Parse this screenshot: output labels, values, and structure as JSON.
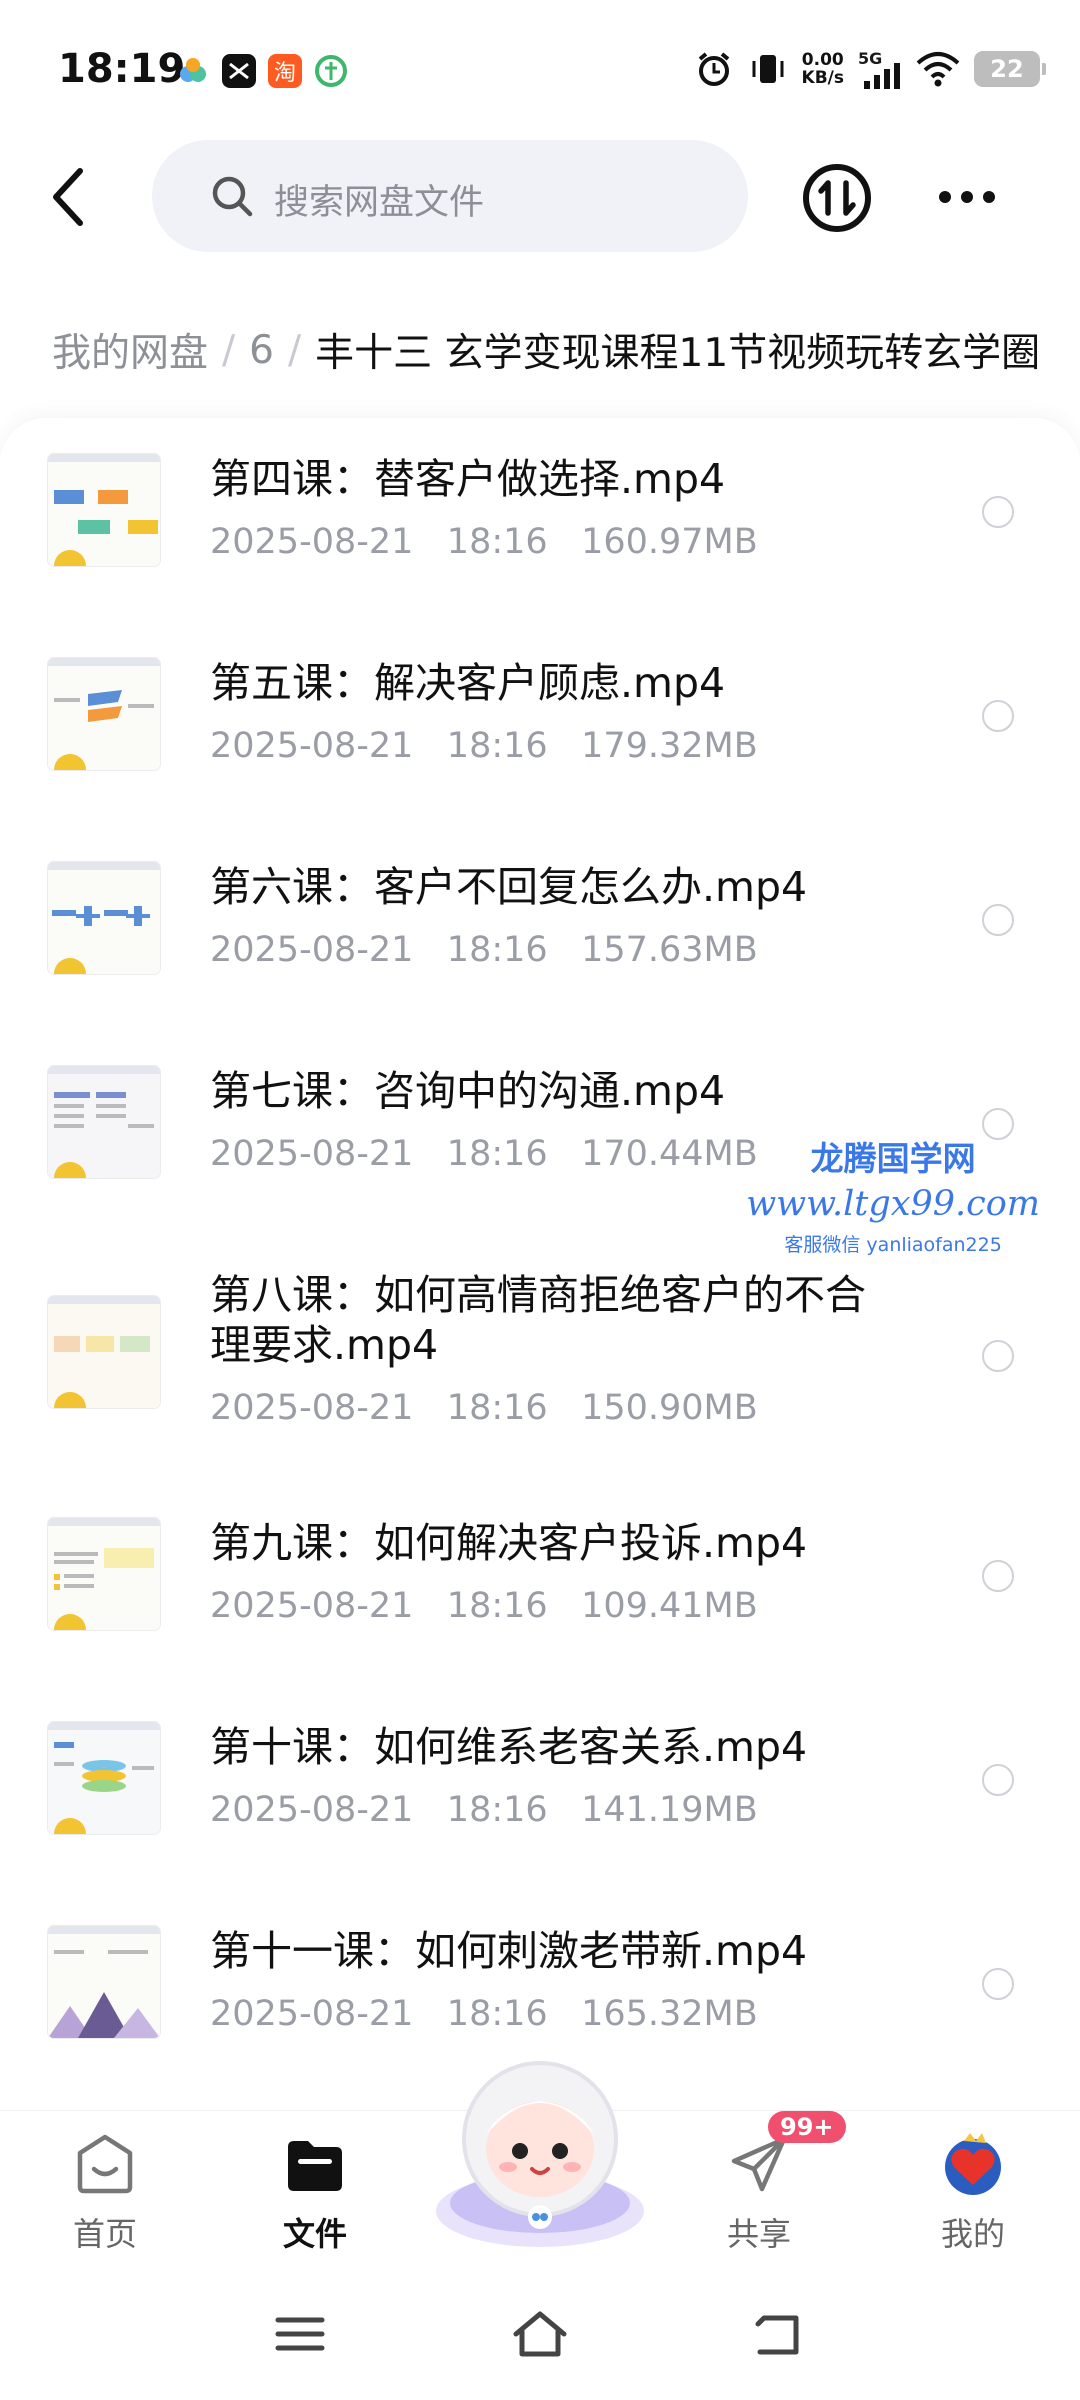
{
  "status_bar": {
    "time": "18:19",
    "net_speed_value": "0.00",
    "net_speed_unit": "KB/s",
    "signal_label": "5G",
    "battery": "22"
  },
  "header": {
    "search_placeholder": "搜索网盘文件"
  },
  "breadcrumb": {
    "root": "我的网盘",
    "separator": "/",
    "level1": "6",
    "current": "丰十三 玄学变现课程11节视频玩转玄学圈"
  },
  "files": [
    {
      "name": "第四课：替客户做选择.mp4",
      "date": "2025-08-21",
      "time": "18:16",
      "size": "160.97MB"
    },
    {
      "name": "第五课：解决客户顾虑.mp4",
      "date": "2025-08-21",
      "time": "18:16",
      "size": "179.32MB"
    },
    {
      "name": "第六课：客户不回复怎么办.mp4",
      "date": "2025-08-21",
      "time": "18:16",
      "size": "157.63MB"
    },
    {
      "name": "第七课：咨询中的沟通.mp4",
      "date": "2025-08-21",
      "time": "18:16",
      "size": "170.44MB"
    },
    {
      "name": "第八课：如何高情商拒绝客户的不合理要求.mp4",
      "date": "2025-08-21",
      "time": "18:16",
      "size": "150.90MB"
    },
    {
      "name": "第九课：如何解决客户投诉.mp4",
      "date": "2025-08-21",
      "time": "18:16",
      "size": "109.41MB"
    },
    {
      "name": "第十课：如何维系老客关系.mp4",
      "date": "2025-08-21",
      "time": "18:16",
      "size": "141.19MB"
    },
    {
      "name": "第十一课：如何刺激老带新.mp4",
      "date": "2025-08-21",
      "time": "18:16",
      "size": "165.32MB"
    }
  ],
  "watermark": {
    "line1": "龙腾国学网",
    "line2": "www.ltgx99.com",
    "line3": "客服微信 yanliaofan225"
  },
  "tabs": [
    {
      "label": "首页",
      "icon": "home-icon"
    },
    {
      "label": "文件",
      "icon": "folder-icon"
    },
    {
      "label": "共享",
      "icon": "share-icon",
      "badge": "99+"
    },
    {
      "label": "我的",
      "icon": "avatar-icon"
    }
  ],
  "colors": {
    "accent": "#111111",
    "muted_text": "#9a9da5",
    "search_bg": "#f1f2f8",
    "badge": "#f0506e",
    "watermark": "#3b78e7"
  }
}
